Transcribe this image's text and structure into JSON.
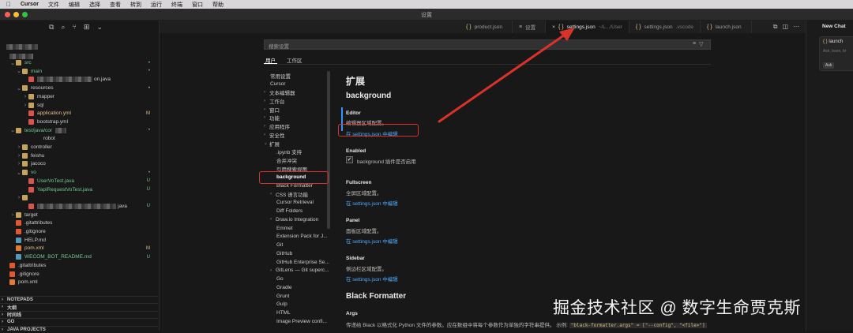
{
  "menubar": {
    "app": "Cursor",
    "items": [
      "文件",
      "编辑",
      "选择",
      "查看",
      "转到",
      "运行",
      "终端",
      "窗口",
      "帮助"
    ]
  },
  "window": {
    "title": "设置"
  },
  "explorer": {
    "items": [
      {
        "label": "src",
        "depth": 1,
        "chev": "⌄",
        "icon": "folder",
        "color": "#73c991",
        "badge": "•",
        "badge_color": "#73c991"
      },
      {
        "label": "main",
        "depth": 2,
        "chev": "⌄",
        "icon": "folder",
        "color": "#73c991",
        "badge": "•",
        "badge_color": "#73c991"
      },
      {
        "label": "on.java",
        "depth": 3,
        "chev": "",
        "icon": "java",
        "color": "#cccccc",
        "badge": "",
        "badge_color": "#cccccc"
      },
      {
        "label": "resources",
        "depth": 2,
        "chev": "⌄",
        "icon": "folder",
        "color": "#cccccc",
        "badge": "•",
        "badge_color": "#e2c08d"
      },
      {
        "label": "mapper",
        "depth": 3,
        "chev": "›",
        "icon": "folder",
        "color": "#cccccc",
        "badge": "",
        "badge_color": "#cccccc"
      },
      {
        "label": "sql",
        "depth": 3,
        "chev": "›",
        "icon": "folder",
        "color": "#cccccc",
        "badge": "",
        "badge_color": "#cccccc"
      },
      {
        "label": "application.yml",
        "depth": 3,
        "chev": "",
        "icon": "yml",
        "color": "#e2c08d",
        "badge": "M",
        "badge_color": "#e2c08d"
      },
      {
        "label": "bootstrap.yml",
        "depth": 3,
        "chev": "",
        "icon": "yml",
        "color": "#cccccc",
        "badge": "",
        "badge_color": "#cccccc"
      },
      {
        "label": "test/java/cor",
        "depth": 1,
        "chev": "⌄",
        "icon": "folder",
        "color": "#73c991",
        "badge": "•",
        "badge_color": "#73c991"
      },
      {
        "label": "robot",
        "depth": 4,
        "chev": "",
        "icon": "none",
        "color": "#cccccc",
        "badge": "",
        "badge_color": "#cccccc"
      },
      {
        "label": "controller",
        "depth": 2,
        "chev": "›",
        "icon": "folder",
        "color": "#cccccc",
        "badge": "",
        "badge_color": "#cccccc"
      },
      {
        "label": "feishu",
        "depth": 2,
        "chev": "›",
        "icon": "folder",
        "color": "#cccccc",
        "badge": "",
        "badge_color": "#cccccc"
      },
      {
        "label": "jacoco",
        "depth": 2,
        "chev": "›",
        "icon": "folder",
        "color": "#cccccc",
        "badge": "",
        "badge_color": "#cccccc"
      },
      {
        "label": "vo",
        "depth": 2,
        "chev": "⌄",
        "icon": "folder",
        "color": "#73c991",
        "badge": "•",
        "badge_color": "#73c991"
      },
      {
        "label": "UserVoTest.java",
        "depth": 3,
        "chev": "",
        "icon": "java",
        "color": "#73c991",
        "badge": "U",
        "badge_color": "#73c991"
      },
      {
        "label": "YapiRequestVoTest.java",
        "depth": 3,
        "chev": "",
        "icon": "java",
        "color": "#73c991",
        "badge": "U",
        "badge_color": "#73c991"
      },
      {
        "label": "",
        "depth": 2,
        "chev": "›",
        "icon": "folder",
        "color": "#cccccc",
        "badge": "",
        "badge_color": "#cccccc"
      },
      {
        "label": "java",
        "depth": 3,
        "chev": "",
        "icon": "java",
        "color": "#cccccc",
        "badge": "U",
        "badge_color": "#73c991"
      },
      {
        "label": "target",
        "depth": 1,
        "chev": "›",
        "icon": "folder",
        "color": "#cccccc",
        "badge": "",
        "badge_color": "#cccccc"
      },
      {
        "label": ".gitattributes",
        "depth": 1,
        "chev": "",
        "icon": "git",
        "color": "#cccccc",
        "badge": "",
        "badge_color": "#cccccc"
      },
      {
        "label": ".gitignore",
        "depth": 1,
        "chev": "",
        "icon": "git",
        "color": "#cccccc",
        "badge": "",
        "badge_color": "#cccccc"
      },
      {
        "label": "HELP.md",
        "depth": 1,
        "chev": "",
        "icon": "md",
        "color": "#cccccc",
        "badge": "",
        "badge_color": "#cccccc"
      },
      {
        "label": "pom.xml",
        "depth": 1,
        "chev": "",
        "icon": "xml",
        "color": "#e2c08d",
        "badge": "M",
        "badge_color": "#e2c08d"
      },
      {
        "label": "WECOM_BOT_README.md",
        "depth": 1,
        "chev": "",
        "icon": "md",
        "color": "#73c991",
        "badge": "U",
        "badge_color": "#73c991"
      },
      {
        "label": ".gitattributes",
        "depth": 0,
        "chev": "",
        "icon": "git",
        "color": "#cccccc",
        "badge": "",
        "badge_color": "#cccccc"
      },
      {
        "label": ".gitignore",
        "depth": 0,
        "chev": "",
        "icon": "git",
        "color": "#cccccc",
        "badge": "",
        "badge_color": "#cccccc"
      },
      {
        "label": "pom.xml",
        "depth": 0,
        "chev": "",
        "icon": "xml",
        "color": "#cccccc",
        "badge": "",
        "badge_color": "#cccccc"
      }
    ],
    "sections": [
      "NOTEPADS",
      "大纲",
      "时间线",
      "GO",
      "JAVA PROJECTS"
    ]
  },
  "tabs": [
    {
      "label": "product.json",
      "dim": "",
      "icon": "{ }",
      "active": false
    },
    {
      "label": "设置",
      "dim": "",
      "icon": "≡",
      "active": false
    },
    {
      "label": "settings.json",
      "dim": "~/L.../User",
      "icon": "{ }",
      "active": true
    },
    {
      "label": "settings.json",
      "dim": ".vscode",
      "icon": "{ }",
      "active": false
    },
    {
      "label": "launch.json",
      "dim": "",
      "icon": "{ }",
      "active": false
    }
  ],
  "settings": {
    "search_placeholder": "搜索设置",
    "scopes": [
      "用户",
      "工作区"
    ],
    "toc": [
      {
        "label": "常用设置",
        "chev": ""
      },
      {
        "label": "Cursor",
        "chev": ""
      },
      {
        "label": "文本编辑器",
        "chev": "›"
      },
      {
        "label": "工作台",
        "chev": "›"
      },
      {
        "label": "窗口",
        "chev": "›"
      },
      {
        "label": "功能",
        "chev": "›"
      },
      {
        "label": "应用程序",
        "chev": "›"
      },
      {
        "label": "安全性",
        "chev": "›"
      },
      {
        "label": "扩展",
        "chev": "⌄"
      },
      {
        "label": ".ipynb 支持",
        "chev": ""
      },
      {
        "label": "合并冲突",
        "chev": ""
      },
      {
        "label": "引用搜索视图",
        "chev": ""
      },
      {
        "label": "background",
        "chev": ""
      },
      {
        "label": "Black Formatter",
        "chev": ""
      },
      {
        "label": "CSS 语言功能",
        "chev": "›"
      },
      {
        "label": "Cursor Retrieval",
        "chev": ""
      },
      {
        "label": "Diff Folders",
        "chev": ""
      },
      {
        "label": "Draw.io Integration",
        "chev": "›"
      },
      {
        "label": "Emmet",
        "chev": ""
      },
      {
        "label": "Extension Pack for J...",
        "chev": ""
      },
      {
        "label": "Git",
        "chev": ""
      },
      {
        "label": "GitHub",
        "chev": ""
      },
      {
        "label": "GitHub Enterprise Se...",
        "chev": ""
      },
      {
        "label": "GitLens — Git superc...",
        "chev": "›"
      },
      {
        "label": "Go",
        "chev": ""
      },
      {
        "label": "Gradle",
        "chev": ""
      },
      {
        "label": "Grunt",
        "chev": ""
      },
      {
        "label": "Gulp",
        "chev": ""
      },
      {
        "label": "HTML",
        "chev": ""
      },
      {
        "label": "Image Preview confi...",
        "chev": ""
      }
    ],
    "heading": "扩展",
    "group": "background",
    "editor": {
      "title": "Editor",
      "desc": "编辑器区域配置。",
      "link": "在 settings.json 中编辑"
    },
    "enabled": {
      "title": "Enabled",
      "checkbox": "✓",
      "desc": "background 插件是否启用"
    },
    "fullscreen": {
      "title": "Fullscreen",
      "desc": "全屏区域配置。",
      "link": "在 settings.json 中编辑"
    },
    "panel": {
      "title": "Panel",
      "desc": "面板区域配置。",
      "link": "在 settings.json 中编辑"
    },
    "sidebar": {
      "title": "Sidebar",
      "desc": "侧边栏区域配置。",
      "link": "在 settings.json 中编辑"
    },
    "black": {
      "heading": "Black Formatter",
      "args_title": "Args",
      "args_desc": "传递给 Black 以格式化 Python 文件的参数。应在数组中将每个参数作为单独的字符串提供。 示例:",
      "args_code": "\"black-formatter.args\" = [\"--config\", \"<file>\"]"
    }
  },
  "chat": {
    "title": "New Chat",
    "card_title": "launch",
    "card_sub": "Ask, learn, br",
    "ask": "Ask"
  },
  "watermark": "掘金技术社区 @ 数字生命贾克斯",
  "colors": {
    "link": "#4daafc",
    "annotation": "#d9322a",
    "git_added": "#73c991",
    "git_modified": "#e2c08d"
  }
}
